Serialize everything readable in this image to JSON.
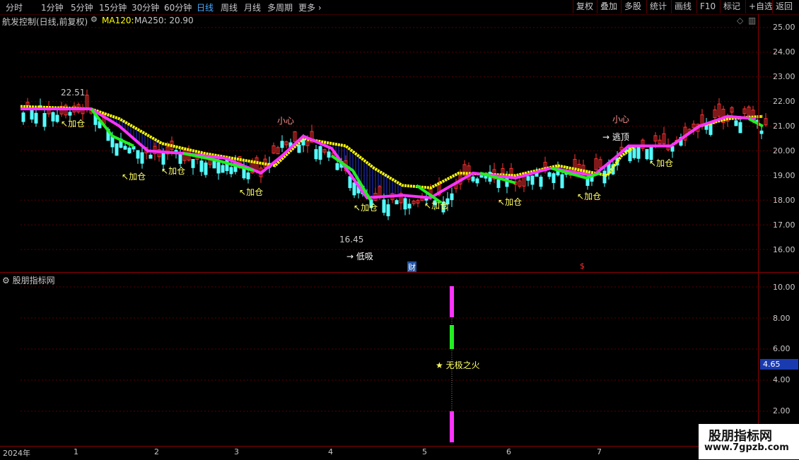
{
  "toolbar": {
    "periods": [
      "分时",
      "1分钟",
      "5分钟",
      "15分钟",
      "30分钟",
      "60分钟",
      "日线",
      "周线",
      "月线",
      "多周期",
      "更多"
    ],
    "active_period": "日线",
    "right_buttons": [
      "复权",
      "叠加",
      "多股",
      "统计",
      "画线",
      "F10",
      "标记",
      "+自选",
      "返回"
    ]
  },
  "main_panel": {
    "title": "航发控制(日线,前复权)",
    "ma120_label": "MA120:",
    "ma250_label": "MA250: 20.90",
    "high_marker": "22.51",
    "low_marker": "16.45",
    "low_buy_label": "→ 低吸",
    "caution_label": "小心",
    "escape_label": "逃顶",
    "add_position_label": "加仓",
    "finance_marker": "财",
    "dollar_marker": "$"
  },
  "sub_panel": {
    "title": "股朋指标网",
    "signal_label": "★ 无极之火",
    "current_value": "4.65"
  },
  "y_axis_main": [
    "25.00",
    "24.00",
    "23.00",
    "22.00",
    "21.00",
    "20.00",
    "19.00",
    "18.00",
    "17.00",
    "16.00"
  ],
  "y_axis_sub": [
    "10.00",
    "8.00",
    "6.00",
    "4.00",
    "2.00"
  ],
  "date_axis": [
    "2024年",
    "1",
    "2",
    "3",
    "4",
    "5",
    "6",
    "7"
  ],
  "watermark": {
    "line1": "股朋指标网",
    "line2": "www.7gpzb.com"
  },
  "colors": {
    "up": "#ff3232",
    "down": "#54ffff",
    "ma_yellow": "#ffff00",
    "line_magenta": "#ff33ff",
    "line_green": "#22ee22",
    "axis": "#8b0000"
  }
}
